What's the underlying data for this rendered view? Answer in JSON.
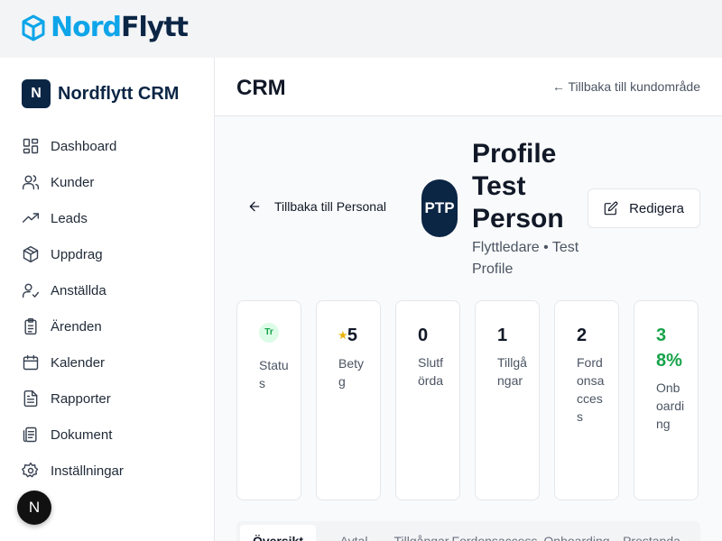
{
  "brand": {
    "part1": "Nord",
    "part2": "Flytt",
    "icon": "cube-logo-icon"
  },
  "sidebar": {
    "logo_letter": "N",
    "title": "Nordflytt CRM",
    "items": [
      {
        "label": "Dashboard",
        "icon": "dashboard-icon"
      },
      {
        "label": "Kunder",
        "icon": "users-icon"
      },
      {
        "label": "Leads",
        "icon": "trending-up-icon"
      },
      {
        "label": "Uppdrag",
        "icon": "package-icon"
      },
      {
        "label": "Anställda",
        "icon": "user-check-icon"
      },
      {
        "label": "Ärenden",
        "icon": "clipboard-icon"
      },
      {
        "label": "Kalender",
        "icon": "calendar-icon"
      },
      {
        "label": "Rapporter",
        "icon": "file-text-icon"
      },
      {
        "label": "Dokument",
        "icon": "document-stack-icon"
      },
      {
        "label": "Inställningar",
        "icon": "gear-icon"
      }
    ],
    "badge_letter": "N"
  },
  "header": {
    "title": "CRM",
    "back_link": "← Tillbaka till kundområde"
  },
  "profile": {
    "back_label": "Tillbaka till Personal",
    "initials": "PTP",
    "name": "Profile Test Person",
    "subtitle": "Flyttledare • Test Profile",
    "edit_label": "Redigera"
  },
  "stats": [
    {
      "value": "Tr",
      "label": "Status",
      "kind": "status"
    },
    {
      "value": "5",
      "label": "Betyg",
      "kind": "rating"
    },
    {
      "value": "0",
      "label": "Slutförda",
      "kind": "number"
    },
    {
      "value": "1",
      "label": "Tillgångar",
      "kind": "number"
    },
    {
      "value": "2",
      "label": "Fordonsaccess",
      "kind": "number"
    },
    {
      "value": "38%",
      "label": "Onboarding",
      "kind": "percent"
    }
  ],
  "tabs": [
    "Översikt",
    "Avtal",
    "Tillgångar",
    "Fordonsaccess",
    "Onboarding",
    "Prestanda"
  ],
  "colors": {
    "brand_light": "#0ea5e9",
    "brand_dark": "#0b2545",
    "success": "#16a34a"
  }
}
